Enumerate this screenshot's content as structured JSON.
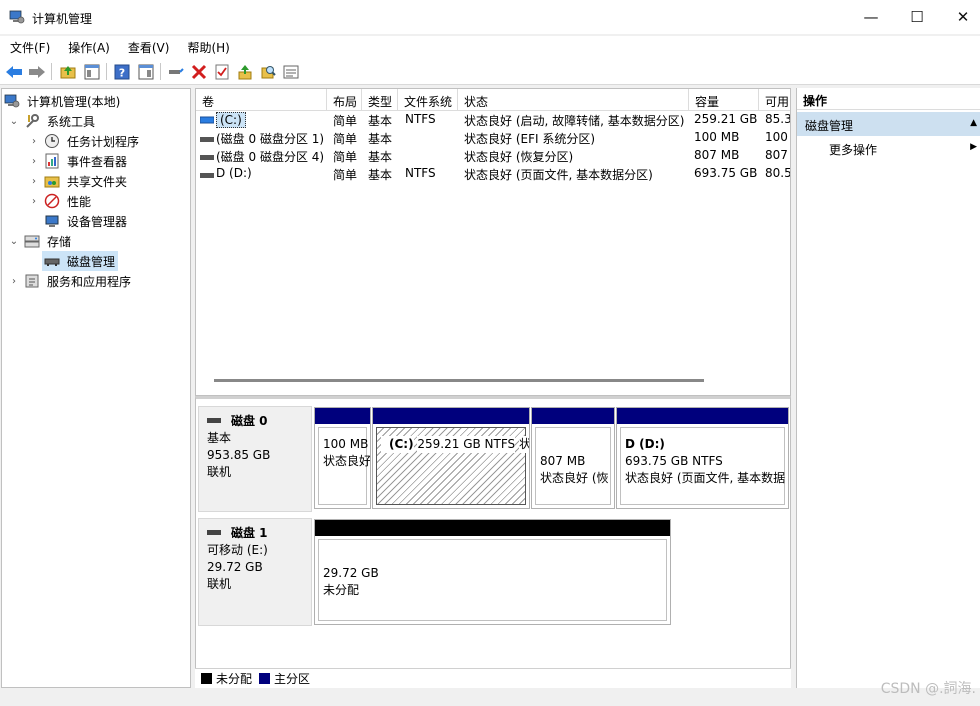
{
  "window": {
    "title": "计算机管理",
    "min": "—",
    "max": "☐",
    "close": "✕"
  },
  "menu": [
    "文件(F)",
    "操作(A)",
    "查看(V)",
    "帮助(H)"
  ],
  "tree": {
    "root": "计算机管理(本地)",
    "system_tools": "系统工具",
    "task_scheduler": "任务计划程序",
    "event_viewer": "事件查看器",
    "shared_folders": "共享文件夹",
    "performance": "性能",
    "device_manager": "设备管理器",
    "storage": "存储",
    "disk_management": "磁盘管理",
    "services": "服务和应用程序"
  },
  "volume_list": {
    "columns": [
      "卷",
      "布局",
      "类型",
      "文件系统",
      "状态",
      "容量",
      "可用"
    ],
    "rows": [
      [
        "(C:)",
        "简单",
        "基本",
        "NTFS",
        "状态良好 (启动, 故障转储, 基本数据分区)",
        "259.21 GB",
        "85.3"
      ],
      [
        "(磁盘 0 磁盘分区 1)",
        "简单",
        "基本",
        "",
        "状态良好 (EFI 系统分区)",
        "100 MB",
        "100"
      ],
      [
        "(磁盘 0 磁盘分区 4)",
        "简单",
        "基本",
        "",
        "状态良好 (恢复分区)",
        "807 MB",
        "807"
      ],
      [
        "D (D:)",
        "简单",
        "基本",
        "NTFS",
        "状态良好 (页面文件, 基本数据分区)",
        "693.75 GB",
        "80.5"
      ]
    ]
  },
  "disks": [
    {
      "name": "磁盘 0",
      "type": "基本",
      "size": "953.85 GB",
      "status": "联机",
      "partitions": [
        {
          "name": "",
          "size": "100 MB",
          "status": "状态良好"
        },
        {
          "name": "(C:)",
          "size": "259.21 GB NTFS",
          "status": "状态良好 (启动, 故障转储, 基"
        },
        {
          "name": "",
          "size": "807 MB",
          "status": "状态良好 (恢"
        },
        {
          "name": "D  (D:)",
          "size": "693.75 GB NTFS",
          "status": "状态良好 (页面文件, 基本数据"
        }
      ]
    },
    {
      "name": "磁盘 1",
      "type": "可移动 (E:)",
      "size": "29.72 GB",
      "status": "联机",
      "partitions": [
        {
          "size": "29.72 GB",
          "status": "未分配"
        }
      ]
    }
  ],
  "legend": {
    "unallocated": "未分配",
    "primary": "主分区"
  },
  "actions": {
    "header": "操作",
    "group": "磁盘管理",
    "more": "更多操作"
  },
  "watermark": "CSDN @.詞海.",
  "colors": {
    "primary_partition": "#00007d",
    "unallocated": "#000000",
    "selected": "#cce4f7",
    "action_group": "#cde0f0"
  }
}
